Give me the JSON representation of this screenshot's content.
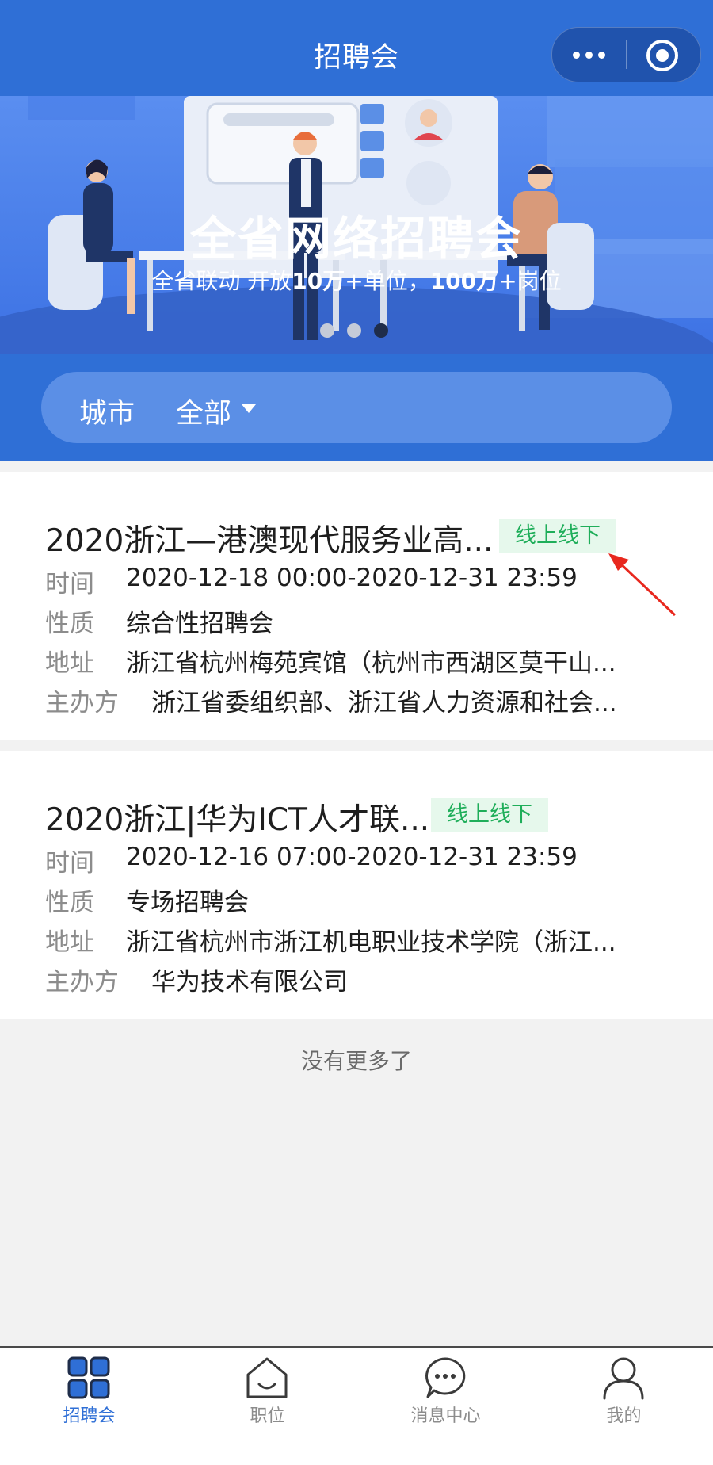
{
  "header": {
    "title": "招聘会"
  },
  "banner": {
    "title": "全省网络招聘会",
    "subtitle_prefix": "全省联动 开放",
    "subtitle_num1": "10万",
    "subtitle_mid": "+单位，",
    "subtitle_num2": "100万",
    "subtitle_suffix": "+岗位",
    "carousel": {
      "count": 3,
      "active_index": 2
    }
  },
  "filter": {
    "label": "城市",
    "value": "全部"
  },
  "fairs": [
    {
      "title": "2020浙江—港澳现代服务业高...",
      "tag": "线上线下",
      "rows": [
        {
          "label": "时间",
          "value": "2020-12-18 00:00-2020-12-31 23:59"
        },
        {
          "label": "性质",
          "value": "综合性招聘会"
        },
        {
          "label": "地址",
          "value": "浙江省杭州梅苑宾馆（杭州市西湖区莫干山..."
        },
        {
          "label": "主办方",
          "value": "浙江省委组织部、浙江省人力资源和社会..."
        }
      ]
    },
    {
      "title": "2020浙江|华为ICT人才联...",
      "tag": "线上线下",
      "rows": [
        {
          "label": "时间",
          "value": "2020-12-16 07:00-2020-12-31 23:59"
        },
        {
          "label": "性质",
          "value": "专场招聘会"
        },
        {
          "label": "地址",
          "value": "浙江省杭州市浙江机电职业技术学院（浙江..."
        },
        {
          "label": "主办方",
          "value": "华为技术有限公司"
        }
      ]
    }
  ],
  "list_end_text": "没有更多了",
  "tabbar": {
    "items": [
      {
        "label": "招聘会",
        "icon": "grid-icon",
        "active": true
      },
      {
        "label": "职位",
        "icon": "house-icon",
        "active": false
      },
      {
        "label": "消息中心",
        "icon": "chat-bubble-icon",
        "active": false
      },
      {
        "label": "我的",
        "icon": "person-icon",
        "active": false
      }
    ]
  },
  "colors": {
    "primary": "#2f6fd6",
    "tag_bg": "#e6f8ec",
    "tag_text": "#1fae5a",
    "annotation_arrow": "#e8281e"
  }
}
